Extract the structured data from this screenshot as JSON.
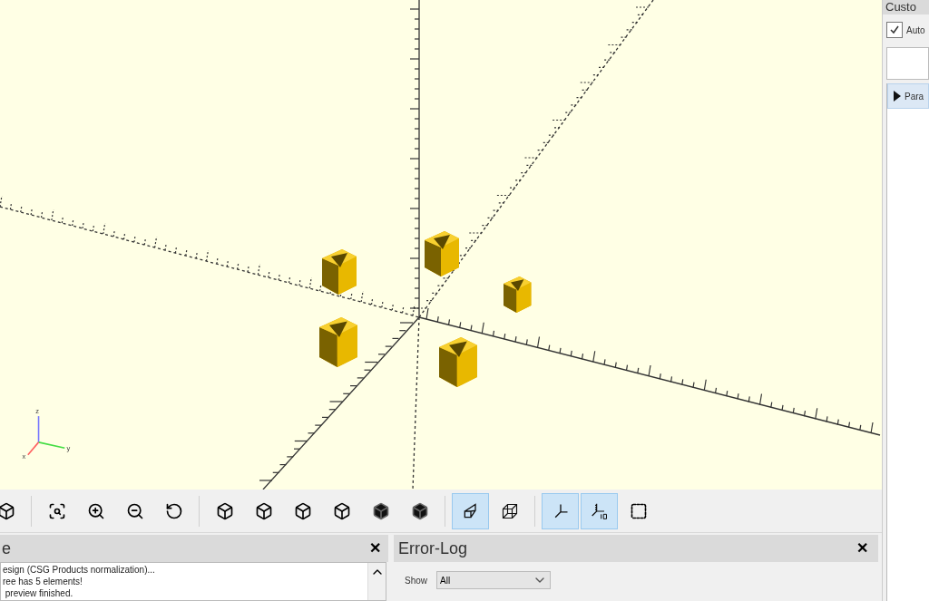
{
  "viewport": {
    "gizmo": {
      "x_label": "x",
      "y_label": "y",
      "z_label": "z"
    }
  },
  "toolbar": [
    {
      "kind": "render",
      "selected": false
    },
    {
      "kind": "separator"
    },
    {
      "kind": "view-all",
      "selected": false
    },
    {
      "kind": "zoom-in",
      "selected": false
    },
    {
      "kind": "zoom-out",
      "selected": false
    },
    {
      "kind": "reset-view",
      "selected": false
    },
    {
      "kind": "separator"
    },
    {
      "kind": "view-right",
      "selected": false
    },
    {
      "kind": "view-top",
      "selected": false
    },
    {
      "kind": "view-bottom",
      "selected": false
    },
    {
      "kind": "view-left",
      "selected": false
    },
    {
      "kind": "view-front",
      "selected": false
    },
    {
      "kind": "view-back",
      "selected": false
    },
    {
      "kind": "separator"
    },
    {
      "kind": "perspective",
      "selected": true
    },
    {
      "kind": "orthogonal",
      "selected": false
    },
    {
      "kind": "separator"
    },
    {
      "kind": "axes",
      "selected": true
    },
    {
      "kind": "scale-markers",
      "selected": true
    },
    {
      "kind": "edges",
      "selected": false
    }
  ],
  "console": {
    "title": "e",
    "lines": [
      "esign (CSG Products normalization)...",
      "ree has 5 elements!",
      " preview finished."
    ],
    "close": "✕"
  },
  "error_log": {
    "title": "Error-Log",
    "close": "✕",
    "show_label": "Show",
    "show_value": "All"
  },
  "customizer": {
    "title": "Custo",
    "auto_label": "Auto",
    "auto_checked": true,
    "tree_item": "Para"
  }
}
